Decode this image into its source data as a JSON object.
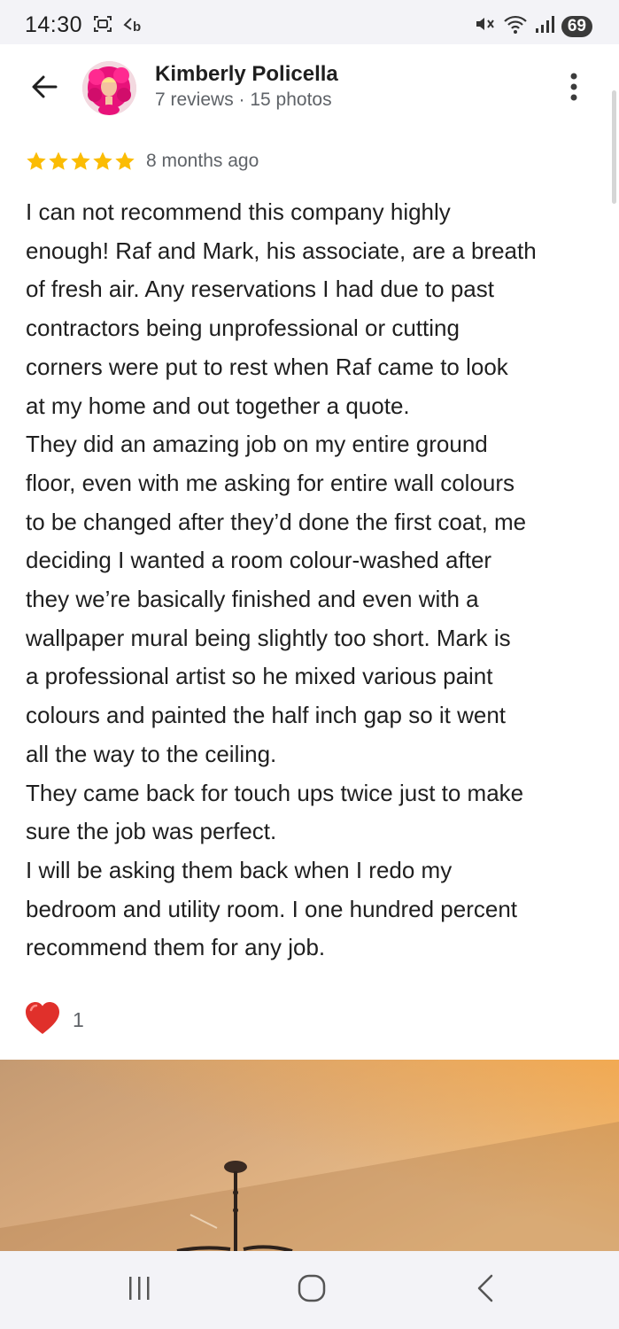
{
  "status_bar": {
    "time": "14:30",
    "battery": "69",
    "icons": [
      "screenshot-icon",
      "notification-b-icon",
      "mute-icon",
      "wifi-icon",
      "signal-icon"
    ]
  },
  "header": {
    "reviewer_name": "Kimberly Policella",
    "reviewer_meta": "7 reviews · 15 photos",
    "back_icon": "arrow-back-icon",
    "more_icon": "more-vert-icon"
  },
  "review": {
    "rating": 5,
    "max_rating": 5,
    "star_color": "#fbbc04",
    "time_ago": "8 months ago",
    "lines": [
      "I can not recommend this company highly",
      "enough! Raf and Mark, his associate, are a breath",
      "of fresh air. Any reservations I had due to past",
      "contractors being unprofessional or cutting",
      "corners were put to rest when Raf came to look",
      "at my home and out together a quote.",
      "They did an amazing job on my entire ground",
      "floor, even with me asking for entire wall colours",
      "to be changed after they’d done the first coat, me",
      "deciding I wanted a room colour-washed after",
      "they we’re basically finished and even with a",
      "wallpaper mural being slightly too short. Mark is",
      "a professional artist so he mixed various paint",
      "colours and painted the half inch gap so it went",
      "all the way to the ceiling.",
      "They came back for touch ups twice just to make",
      "sure the job was perfect.",
      "I will be asking them back when I redo my",
      "bedroom and utility room. I one hundred percent",
      "recommend them for any job."
    ]
  },
  "reactions": {
    "icon": "heart-icon",
    "count": "1"
  },
  "nav_bar": {
    "items": [
      "recents-icon",
      "home-icon",
      "back-icon"
    ]
  }
}
